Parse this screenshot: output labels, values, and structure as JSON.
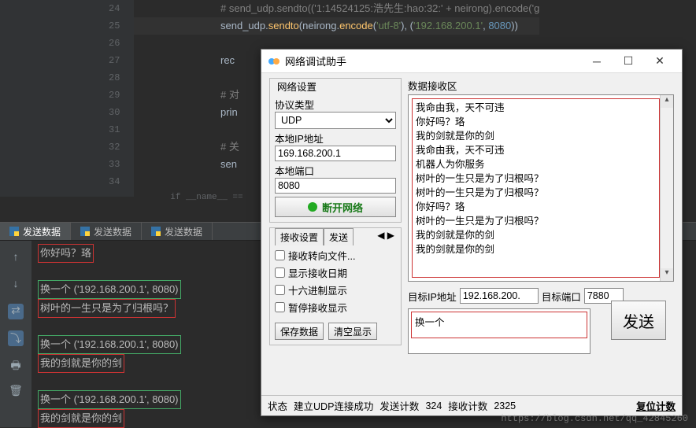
{
  "editor": {
    "lines": [
      {
        "n": "24",
        "pre": "# ",
        "code": "send_udp.sendto(('1:14524125:浩先生:hao:32:' + neirong).encode('g",
        "cls": "comment"
      },
      {
        "n": "25",
        "pre": "",
        "code": "send_udp.sendto(neirong.encode('utf-8'), ('192.168.200.1', 8080))",
        "cls": "code"
      },
      {
        "n": "26",
        "pre": "",
        "code": "",
        "cls": ""
      },
      {
        "n": "27",
        "pre": "",
        "code": "recv",
        "cls": "plain"
      },
      {
        "n": "28",
        "pre": "",
        "code": "",
        "cls": ""
      },
      {
        "n": "29",
        "pre": "# ",
        "code": "对",
        "cls": "comment"
      },
      {
        "n": "30",
        "pre": "",
        "code": "prin",
        "cls": "plain"
      },
      {
        "n": "31",
        "pre": "",
        "code": "",
        "cls": ""
      },
      {
        "n": "32",
        "pre": "# ",
        "code": "关",
        "cls": "comment"
      },
      {
        "n": "33",
        "pre": "",
        "code": "send",
        "cls": "plain"
      },
      {
        "n": "34",
        "pre": "",
        "code": "",
        "cls": ""
      }
    ],
    "fold": "if __name__ =="
  },
  "tabs": [
    "发送数据",
    "发送数据",
    "发送数据"
  ],
  "run": {
    "lines": [
      {
        "t": "你好吗？珞",
        "box": true
      },
      {
        "t": "",
        "box": false
      },
      {
        "t": "换一个 ('192.168.200.1', 8080)",
        "box": false
      },
      {
        "t": "树叶的一生只是为了归根吗？",
        "box": true
      },
      {
        "t": "",
        "box": false
      },
      {
        "t": "换一个 ('192.168.200.1', 8080)",
        "box": false
      },
      {
        "t": "我的剑就是你的剑",
        "box": true
      },
      {
        "t": "",
        "box": false
      },
      {
        "t": "换一个 ('192.168.200.1', 8080)",
        "box": false
      },
      {
        "t": "我的剑就是你的剑",
        "box": true
      }
    ]
  },
  "dialog": {
    "title": "网络调试助手",
    "netset_title": "网络设置",
    "proto_label": "协议类型",
    "proto_value": "UDP",
    "localip_label": "本地IP地址",
    "localip_value": "169.168.200.1",
    "localport_label": "本地端口",
    "localport_value": "8080",
    "connect_label": "断开网络",
    "recvset_tab": "接收设置",
    "sendset_tab": "发送",
    "arrow": "◀ ▶",
    "chk_forward": "接收转向文件...",
    "chk_date": "显示接收日期",
    "chk_hex": "十六进制显示",
    "chk_pause": "暂停接收显示",
    "save_btn": "保存数据",
    "clear_btn": "清空显示",
    "recv_title": "数据接收区",
    "recv_text": "我命由我，天不可违\n你好吗？珞\n我的剑就是你的剑\n我命由我，天不可违\n机器人为你服务\n树叶的一生只是为了归根吗？\n树叶的一生只是为了归根吗？\n你好吗？珞\n树叶的一生只是为了归根吗？\n我的剑就是你的剑\n我的剑就是你的剑",
    "dest_ip_label": "目标IP地址",
    "dest_ip_value": "192.168.200.",
    "dest_port_label": "目标端口",
    "dest_port_value": "7880",
    "send_text": "换一个",
    "send_btn": "发送",
    "status_label": "状态",
    "status_value": "建立UDP连接成功",
    "sendcnt_label": "发送计数",
    "sendcnt_value": "324",
    "recvcnt_label": "接收计数",
    "recvcnt_value": "2325",
    "reset_label": "复位计数"
  },
  "watermark": "https://blog.csdn.net/qq_42845260"
}
